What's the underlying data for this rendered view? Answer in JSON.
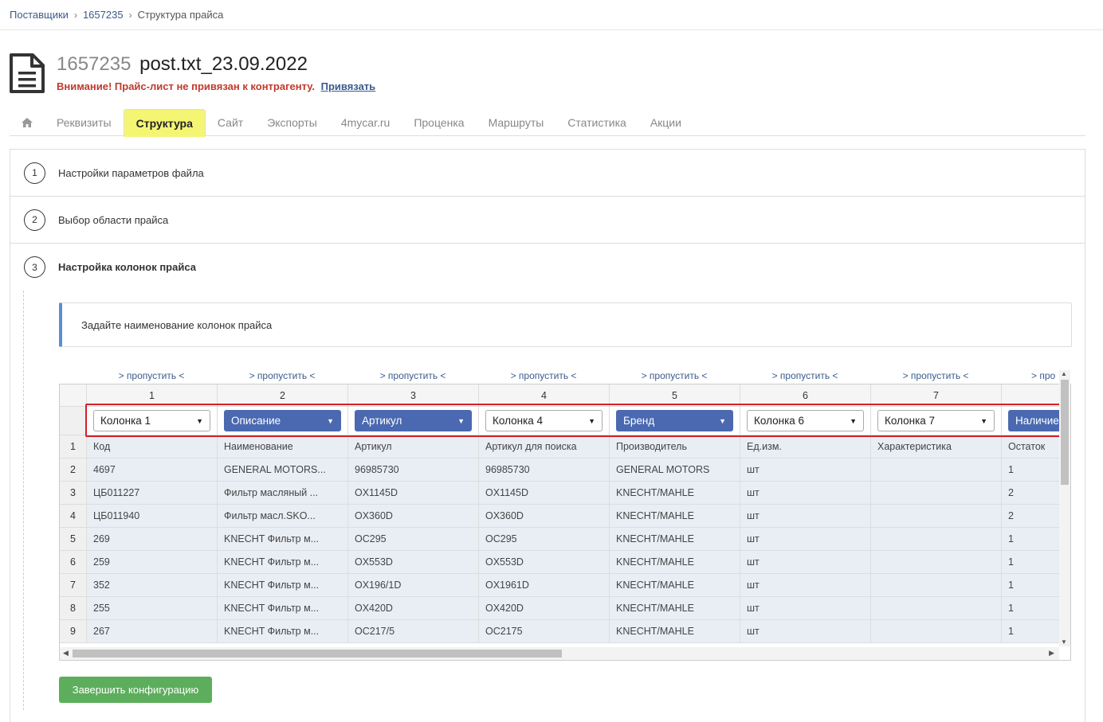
{
  "breadcrumb": {
    "item1": "Поставщики",
    "item2": "1657235",
    "item3": "Структура прайса"
  },
  "header": {
    "number": "1657235",
    "filename": "post.txt_23.09.2022",
    "warning": "Внимание! Прайс-лист не привязан к контрагенту.",
    "link": "Привязать"
  },
  "tabs": [
    "Реквизиты",
    "Структура",
    "Сайт",
    "Экспорты",
    "4mycar.ru",
    "Проценка",
    "Маршруты",
    "Статистика",
    "Акции"
  ],
  "steps": [
    {
      "num": "1",
      "label": "Настройки параметров файла"
    },
    {
      "num": "2",
      "label": "Выбор области прайса"
    },
    {
      "num": "3",
      "label": "Настройка колонок прайса"
    }
  ],
  "info": "Задайте наименование колонок прайса",
  "skip_label": "> пропустить <",
  "skip_partial": "> про",
  "columns": [
    "1",
    "2",
    "3",
    "4",
    "5",
    "6",
    "7"
  ],
  "selects": [
    {
      "value": "Колонка 1",
      "style": "white"
    },
    {
      "value": "Описание",
      "style": "blue"
    },
    {
      "value": "Артикул",
      "style": "blue"
    },
    {
      "value": "Колонка 4",
      "style": "white"
    },
    {
      "value": "Бренд",
      "style": "blue"
    },
    {
      "value": "Колонка 6",
      "style": "white"
    },
    {
      "value": "Колонка 7",
      "style": "white"
    },
    {
      "value": "Наличие",
      "style": "blue"
    }
  ],
  "rows": [
    [
      "1",
      "Код",
      "Наименование",
      "Артикул",
      "Артикул для поиска",
      "Производитель",
      "Ед.изм.",
      "Характеристика",
      "Остаток"
    ],
    [
      "2",
      "4697",
      "GENERAL MOTORS...",
      "96985730",
      "96985730",
      "GENERAL MOTORS",
      "шт",
      "",
      "1"
    ],
    [
      "3",
      "ЦБ011227",
      "Фильтр масляный ...",
      "OX1145D",
      "OX1145D",
      "KNECHT/MAHLE",
      "шт",
      "",
      "2"
    ],
    [
      "4",
      "ЦБ011940",
      "Фильтр масл.SKO...",
      "OX360D",
      "OX360D",
      "KNECHT/MAHLE",
      "шт",
      "",
      "2"
    ],
    [
      "5",
      "269",
      "KNECHT Фильтр м...",
      "OC295",
      "OC295",
      "KNECHT/MAHLE",
      "шт",
      "",
      "1"
    ],
    [
      "6",
      "259",
      "KNECHT Фильтр м...",
      "OX553D",
      "OX553D",
      "KNECHT/MAHLE",
      "шт",
      "",
      "1"
    ],
    [
      "7",
      "352",
      "KNECHT Фильтр м...",
      "OX196/1D",
      "OX1961D",
      "KNECHT/MAHLE",
      "шт",
      "",
      "1"
    ],
    [
      "8",
      "255",
      "KNECHT Фильтр м...",
      "OX420D",
      "OX420D",
      "KNECHT/MAHLE",
      "шт",
      "",
      "1"
    ],
    [
      "9",
      "267",
      "KNECHT Фильтр м...",
      "OC217/5",
      "OC2175",
      "KNECHT/MAHLE",
      "шт",
      "",
      "1"
    ]
  ],
  "finish_button": "Завершить конфигурацию",
  "colors": {
    "accent": "#4a69b0",
    "active_tab": "#f5f574",
    "warning": "#c0392b",
    "success": "#5cae5c",
    "highlight_box": "#d42027"
  }
}
